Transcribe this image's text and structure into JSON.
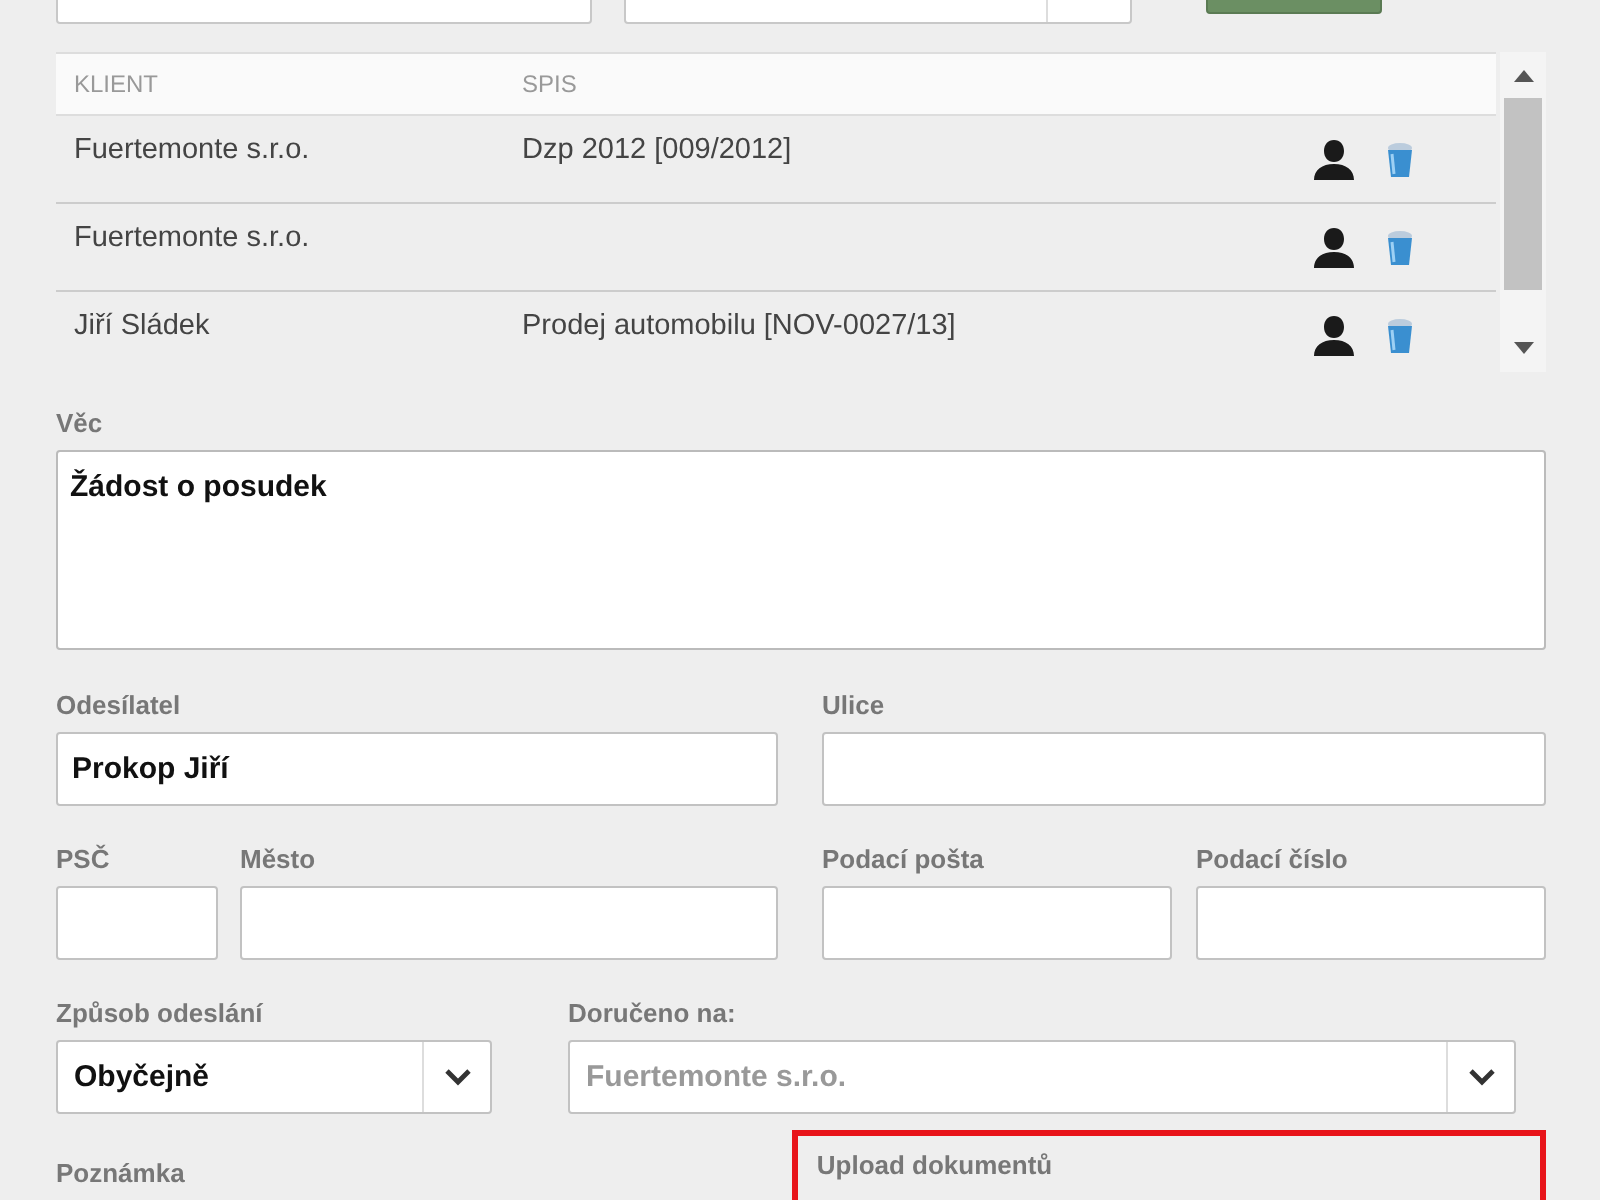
{
  "table": {
    "columns": [
      "KLIENT",
      "SPIS"
    ],
    "rows": [
      {
        "client": "Fuertemonte s.r.o.",
        "file": "Dzp 2012 [009/2012]"
      },
      {
        "client": "Fuertemonte s.r.o."
      },
      {
        "client": "Jiří Sládek",
        "file": "Prodej automobilu [NOV-0027/13]"
      }
    ]
  },
  "subject": {
    "label": "Věc",
    "value": "Žádost o posudek"
  },
  "sender": {
    "label": "Odesílatel",
    "value": "Prokop Jiří"
  },
  "street": {
    "label": "Ulice"
  },
  "zip": {
    "label": "PSČ"
  },
  "city": {
    "label": "Město"
  },
  "post_office": {
    "label": "Podací pošta"
  },
  "post_number": {
    "label": "Podací číslo"
  },
  "send_method": {
    "label": "Způsob odeslání",
    "value": "Obyčejně"
  },
  "delivered_to": {
    "label": "Doručeno na:",
    "placeholder": "Fuertemonte s.r.o."
  },
  "note": {
    "label": "Poznámka"
  },
  "upload": {
    "label": "Upload dokumentů"
  }
}
